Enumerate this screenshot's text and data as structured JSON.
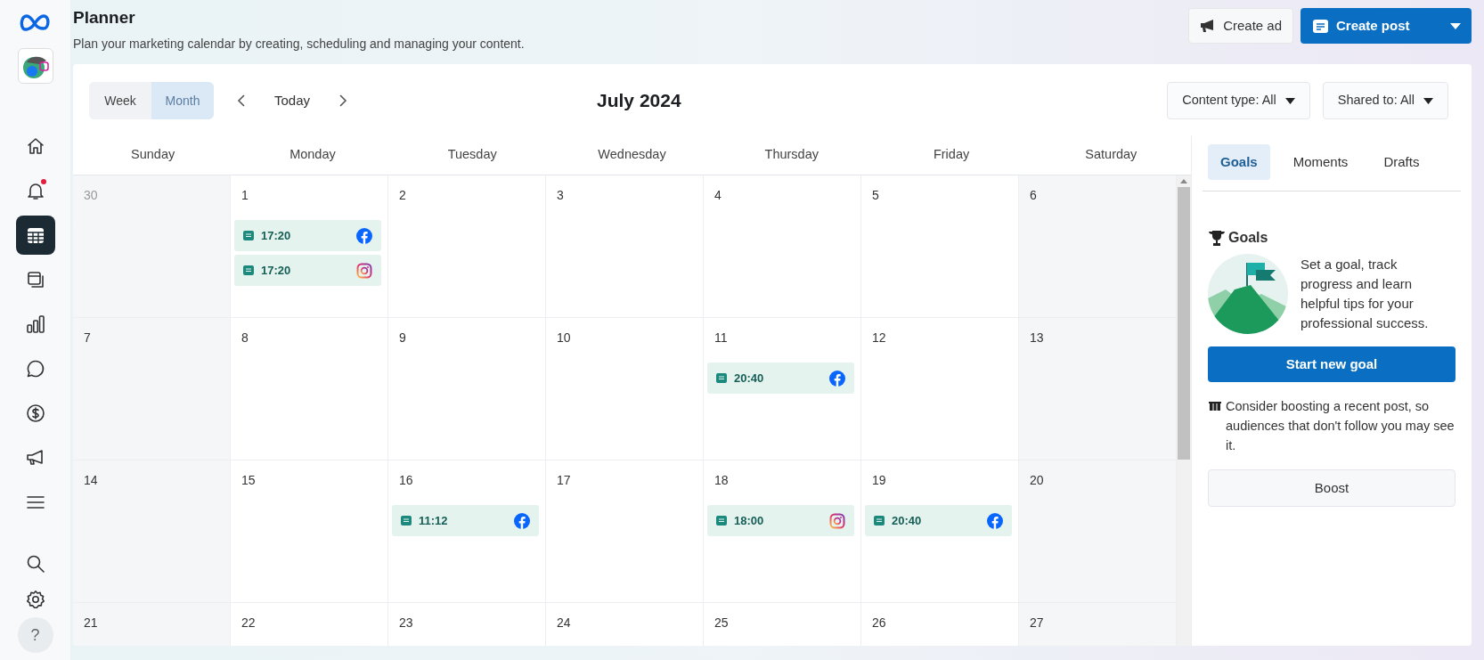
{
  "sidebar": {
    "items": [
      {
        "kind": "home",
        "selected": false,
        "dot": false
      },
      {
        "kind": "bell",
        "selected": false,
        "dot": true
      },
      {
        "kind": "calendar",
        "selected": true,
        "dot": false
      },
      {
        "kind": "pages",
        "selected": false,
        "dot": false
      },
      {
        "kind": "chart",
        "selected": false,
        "dot": false
      },
      {
        "kind": "chat",
        "selected": false,
        "dot": false
      },
      {
        "kind": "dollar",
        "selected": false,
        "dot": false
      },
      {
        "kind": "megaphone",
        "selected": false,
        "dot": false
      },
      {
        "kind": "menu",
        "selected": false,
        "dot": false
      }
    ],
    "bottom_items": [
      {
        "kind": "search"
      },
      {
        "kind": "settings"
      },
      {
        "kind": "help",
        "label": "?"
      }
    ]
  },
  "header": {
    "title": "Planner",
    "subtitle": "Plan your marketing calendar by creating, scheduling and managing your content.",
    "buttons": [
      {
        "kind": "secondary",
        "label": "Create ad"
      },
      {
        "kind": "primary",
        "label": "Create post"
      }
    ]
  },
  "toolbar": {
    "views": [
      {
        "label": "Week",
        "selected": false
      },
      {
        "label": "Month",
        "selected": true
      }
    ],
    "today": "Today",
    "month": "July 2024",
    "filters": [
      "Content type: All",
      "Shared to: All"
    ]
  },
  "calendar": {
    "weekdays": [
      "Sunday",
      "Monday",
      "Tuesday",
      "Wednesday",
      "Thursday",
      "Friday",
      "Saturday"
    ],
    "weeks": [
      [
        {
          "day": "30",
          "muted": true
        },
        {
          "day": "1",
          "muted": false,
          "events": [
            {
              "time": "17:20",
              "kind": "facebook"
            },
            {
              "time": "17:20",
              "kind": "instagram"
            }
          ]
        },
        {
          "day": "2",
          "muted": false
        },
        {
          "day": "3",
          "muted": false
        },
        {
          "day": "4",
          "muted": false
        },
        {
          "day": "5",
          "muted": false
        },
        {
          "day": "6",
          "muted": false
        }
      ],
      [
        {
          "day": "7",
          "muted": false
        },
        {
          "day": "8",
          "muted": false
        },
        {
          "day": "9",
          "muted": false
        },
        {
          "day": "10",
          "muted": false
        },
        {
          "day": "11",
          "muted": false,
          "events": [
            {
              "time": "20:40",
              "kind": "facebook"
            }
          ]
        },
        {
          "day": "12",
          "muted": false
        },
        {
          "day": "13",
          "muted": false
        }
      ],
      [
        {
          "day": "14",
          "muted": false
        },
        {
          "day": "15",
          "muted": false
        },
        {
          "day": "16",
          "muted": false,
          "events": [
            {
              "time": "11:12",
              "kind": "facebook"
            }
          ]
        },
        {
          "day": "17",
          "muted": false
        },
        {
          "day": "18",
          "muted": false,
          "events": [
            {
              "time": "18:00",
              "kind": "instagram"
            }
          ]
        },
        {
          "day": "19",
          "muted": false,
          "events": [
            {
              "time": "20:40",
              "kind": "facebook"
            }
          ]
        },
        {
          "day": "20",
          "muted": false
        }
      ],
      [
        {
          "day": "21",
          "muted": false
        },
        {
          "day": "22",
          "muted": false
        },
        {
          "day": "23",
          "muted": false
        },
        {
          "day": "24",
          "muted": false
        },
        {
          "day": "25",
          "muted": false
        },
        {
          "day": "26",
          "muted": false
        },
        {
          "day": "27",
          "muted": false
        }
      ]
    ]
  },
  "side_panel": {
    "tabs": [
      {
        "label": "Goals",
        "selected": true
      },
      {
        "label": "Moments",
        "selected": false
      },
      {
        "label": "Drafts",
        "selected": false
      }
    ],
    "heading": "Goals",
    "description": "Set a goal, track progress and learn helpful tips for your professional success.",
    "goal_button": "Start new goal",
    "tip": "Consider boosting a recent post, so audiences that don't follow you may see it.",
    "boost_button": "Boost"
  }
}
